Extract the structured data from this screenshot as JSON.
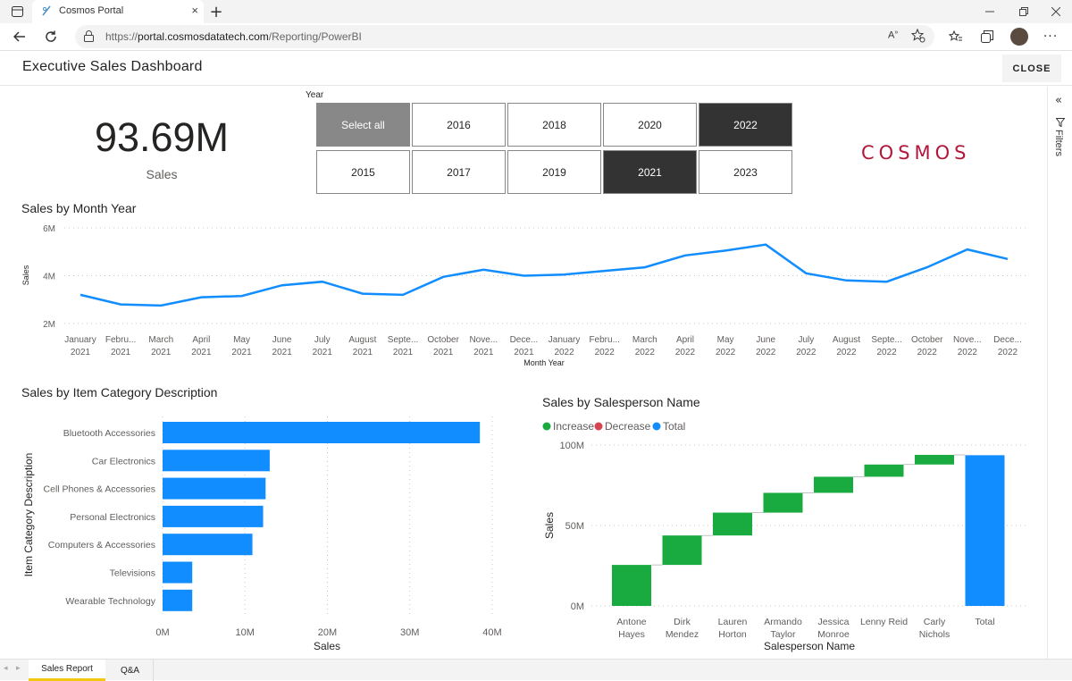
{
  "browser": {
    "tab_title": "Cosmos Portal",
    "url_scheme": "https://",
    "url_host": "portal.cosmosdatatech.com",
    "url_path": "/Reporting/PowerBI"
  },
  "dashboard": {
    "title": "Executive Sales Dashboard",
    "close_label": "CLOSE",
    "filters_label": "Filters"
  },
  "kpi": {
    "value": "93.69M",
    "label": "Sales"
  },
  "slicer": {
    "label": "Year",
    "buttons": [
      {
        "label": "Select all",
        "state": "partial"
      },
      {
        "label": "2016",
        "state": "off"
      },
      {
        "label": "2018",
        "state": "off"
      },
      {
        "label": "2020",
        "state": "off"
      },
      {
        "label": "2022",
        "state": "selected"
      },
      {
        "label": "2015",
        "state": "off"
      },
      {
        "label": "2017",
        "state": "off"
      },
      {
        "label": "2019",
        "state": "off"
      },
      {
        "label": "2021",
        "state": "selected"
      },
      {
        "label": "2023",
        "state": "off"
      }
    ]
  },
  "logo_text": "COSMOS",
  "colors": {
    "line": "#118dff",
    "increase": "#1aab40",
    "decrease": "#d64550",
    "total": "#118dff",
    "brand": "#b0173a",
    "selected": "#333333"
  },
  "tabs": [
    {
      "label": "Sales Report",
      "active": true
    },
    {
      "label": "Q&A",
      "active": false
    }
  ],
  "chart_data": [
    {
      "type": "line",
      "title": "Sales by Month Year",
      "xlabel": "Month Year",
      "ylabel": "Sales",
      "yticks": [
        "6M",
        "4M",
        "2M"
      ],
      "ylim": [
        2,
        6
      ],
      "ytick_values": [
        6,
        4,
        2
      ],
      "categories": [
        [
          "January",
          "2021"
        ],
        [
          "Febru...",
          "2021"
        ],
        [
          "March",
          "2021"
        ],
        [
          "April",
          "2021"
        ],
        [
          "May",
          "2021"
        ],
        [
          "June",
          "2021"
        ],
        [
          "July",
          "2021"
        ],
        [
          "August",
          "2021"
        ],
        [
          "Septe...",
          "2021"
        ],
        [
          "October",
          "2021"
        ],
        [
          "Nove...",
          "2021"
        ],
        [
          "Dece...",
          "2021"
        ],
        [
          "January",
          "2022"
        ],
        [
          "Febru...",
          "2022"
        ],
        [
          "March",
          "2022"
        ],
        [
          "April",
          "2022"
        ],
        [
          "May",
          "2022"
        ],
        [
          "June",
          "2022"
        ],
        [
          "July",
          "2022"
        ],
        [
          "August",
          "2022"
        ],
        [
          "Septe...",
          "2022"
        ],
        [
          "October",
          "2022"
        ],
        [
          "Nove...",
          "2022"
        ],
        [
          "Dece...",
          "2022"
        ]
      ],
      "values": [
        3.2,
        2.8,
        2.75,
        3.1,
        3.15,
        3.6,
        3.75,
        3.25,
        3.2,
        3.95,
        4.25,
        4.0,
        4.05,
        4.2,
        4.35,
        4.85,
        5.05,
        5.3,
        4.1,
        3.8,
        3.75,
        4.35,
        5.1,
        4.7
      ],
      "grid": true
    },
    {
      "type": "bar",
      "orientation": "horizontal",
      "title": "Sales by Item Category Description",
      "xlabel": "Sales",
      "ylabel": "Item Category Description",
      "categories": [
        "Bluetooth Accessories",
        "Car Electronics",
        "Cell Phones & Accessories",
        "Personal Electronics",
        "Computers & Accessories",
        "Televisions",
        "Wearable Technology"
      ],
      "values": [
        38.5,
        13.0,
        12.5,
        12.2,
        10.9,
        3.6,
        3.6
      ],
      "xticks": [
        "0M",
        "10M",
        "20M",
        "30M",
        "40M"
      ],
      "xtick_values": [
        0,
        10,
        20,
        30,
        40
      ],
      "xlim": [
        0,
        40
      ],
      "grid": true
    },
    {
      "type": "waterfall",
      "title": "Sales by Salesperson Name",
      "xlabel": "Salesperson Name",
      "ylabel": "Sales",
      "legend": [
        "Increase",
        "Decrease",
        "Total"
      ],
      "categories": [
        [
          "Antone",
          "Hayes"
        ],
        [
          "Dirk",
          "Mendez"
        ],
        [
          "Lauren",
          "Horton"
        ],
        [
          "Armando",
          "Taylor"
        ],
        [
          "Jessica",
          "Monroe"
        ],
        [
          "Lenny Reid"
        ],
        [
          "Carly",
          "Nichols"
        ],
        [
          "Total"
        ]
      ],
      "values": [
        25.5,
        18.3,
        14.2,
        12.3,
        10.0,
        7.6,
        6.0,
        93.69
      ],
      "kinds": [
        "increase",
        "increase",
        "increase",
        "increase",
        "increase",
        "increase",
        "increase",
        "total"
      ],
      "yticks": [
        "100M",
        "50M",
        "0M"
      ],
      "ytick_values": [
        100,
        50,
        0
      ],
      "ylim": [
        0,
        100
      ],
      "grid": true
    }
  ]
}
